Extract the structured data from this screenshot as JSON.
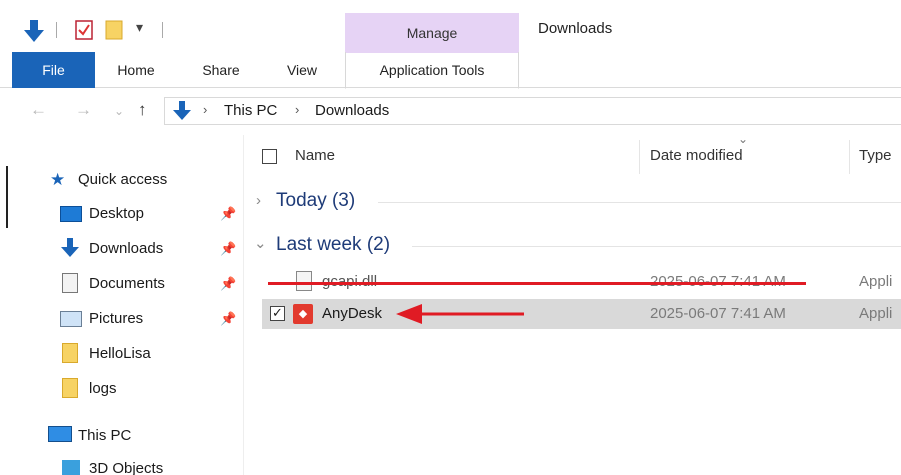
{
  "window": {
    "title": "Downloads"
  },
  "ribbon": {
    "contextual_group": "Manage",
    "tabs": [
      "File",
      "Home",
      "Share",
      "View",
      "Application Tools"
    ]
  },
  "address": {
    "crumbs": [
      "This PC",
      "Downloads"
    ]
  },
  "sidebar": {
    "items": [
      {
        "label": "Quick access",
        "icon": "star-icon"
      },
      {
        "label": "Desktop",
        "icon": "desktop-icon",
        "pinned": true
      },
      {
        "label": "Downloads",
        "icon": "download-icon",
        "pinned": true
      },
      {
        "label": "Documents",
        "icon": "documents-icon",
        "pinned": true
      },
      {
        "label": "Pictures",
        "icon": "pictures-icon",
        "pinned": true
      },
      {
        "label": "HelloLisa",
        "icon": "folder-icon"
      },
      {
        "label": "logs",
        "icon": "folder-icon"
      },
      {
        "label": "This PC",
        "icon": "computer-icon"
      },
      {
        "label": "3D Objects",
        "icon": "cube-icon"
      }
    ]
  },
  "columns": [
    "Name",
    "Date modified",
    "Type"
  ],
  "groups": [
    {
      "label": "Today (3)",
      "expanded": false
    },
    {
      "label": "Last week (2)",
      "expanded": true
    }
  ],
  "files": [
    {
      "name": "gcapi.dll",
      "date": "2025-06-07 7:41 AM",
      "type": "Appli",
      "struck_out": true
    },
    {
      "name": "AnyDesk",
      "date": "2025-06-07 7:41 AM",
      "type": "Appli",
      "selected": true,
      "checked": true
    }
  ],
  "colors": {
    "accent": "#1a64b8",
    "manage_tab": "#e6d3f5",
    "annotation_red": "#e01b24",
    "group_text": "#1e3b78",
    "selection": "#d9d9d9"
  }
}
